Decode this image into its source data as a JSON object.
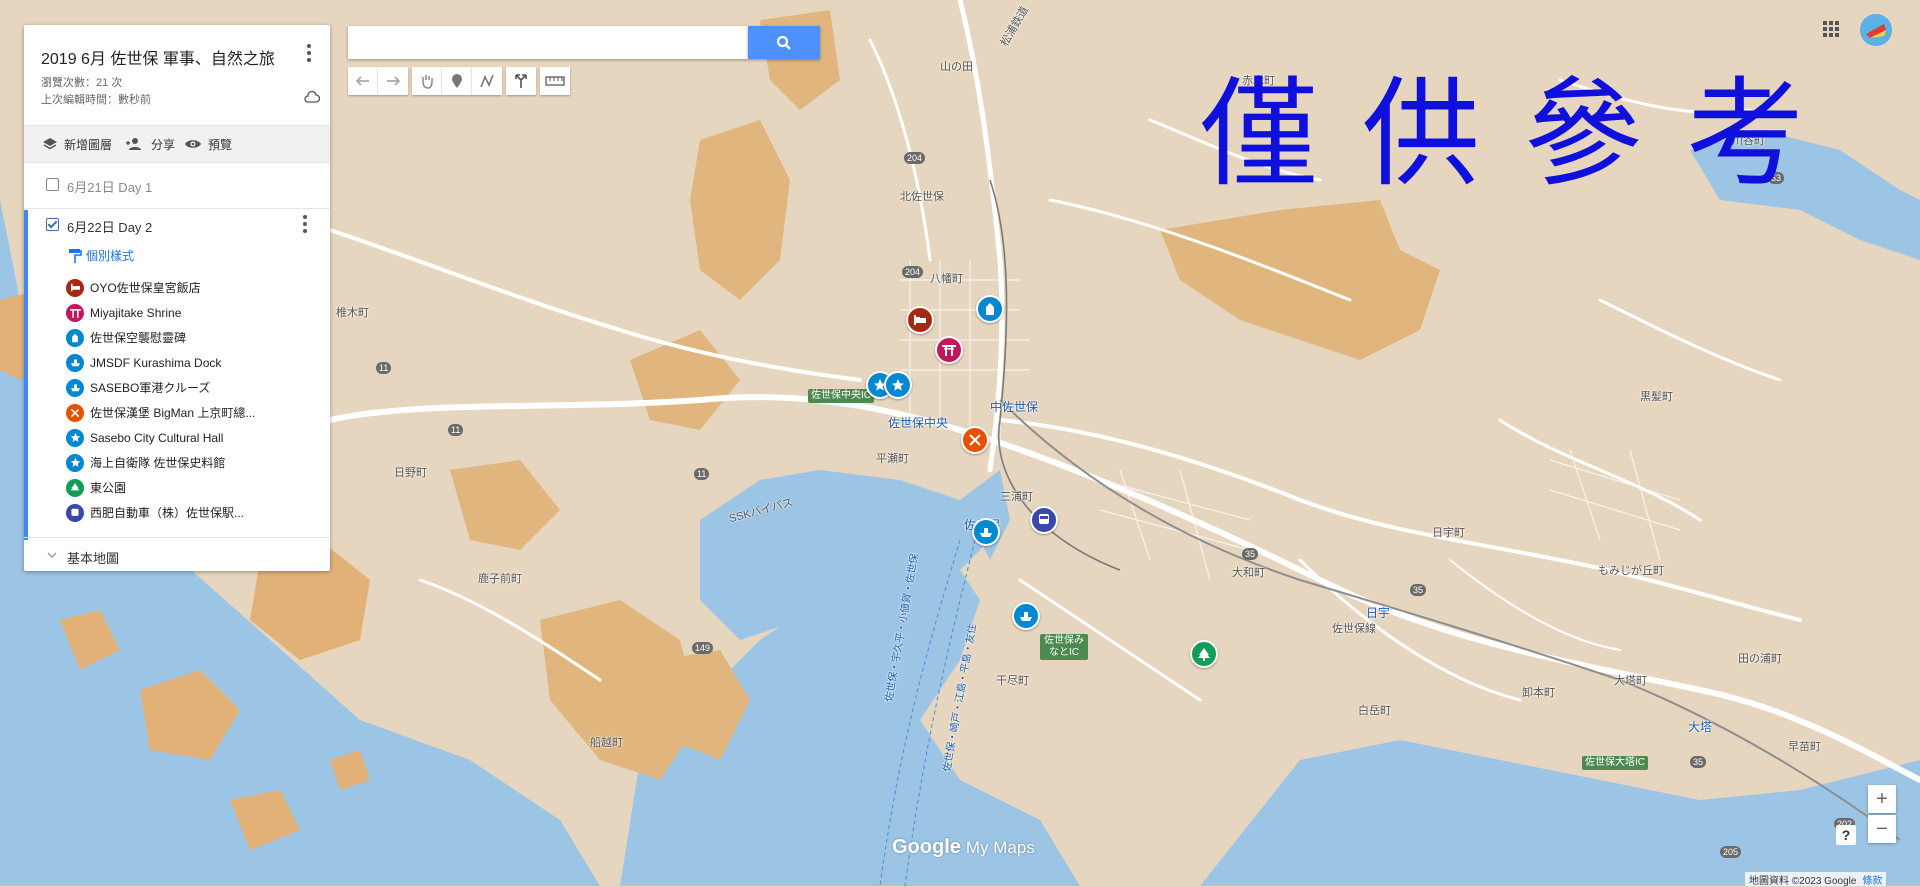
{
  "panel": {
    "title": "2019 6月 佐世保 軍事、自然之旅",
    "views": "瀏覽次數：21 次",
    "last_edit": "上次編輯時間：數秒前",
    "toolbar": {
      "add_layer": "新增圖層",
      "share": "分享",
      "preview": "預覽"
    },
    "layers": [
      {
        "name": "6月21日 Day 1",
        "checked": false
      },
      {
        "name": "6月22日 Day 2",
        "checked": true,
        "style_label": "個別樣式"
      }
    ],
    "places": [
      {
        "name": "OYO佐世保皇宮飯店",
        "color": "#a52714",
        "icon": "bed-icon"
      },
      {
        "name": "Miyajitake Shrine",
        "color": "#c2185b",
        "icon": "torii-icon"
      },
      {
        "name": "佐世保空襲慰靈碑",
        "color": "#0288d1",
        "icon": "monument-icon"
      },
      {
        "name": "JMSDF Kurashima Dock",
        "color": "#0288d1",
        "icon": "ship-icon"
      },
      {
        "name": "SASEBO軍港クルーズ",
        "color": "#0288d1",
        "icon": "ship-icon"
      },
      {
        "name": "佐世保漢堡 BigMan 上京町總...",
        "color": "#e65100",
        "icon": "fork-knife-icon"
      },
      {
        "name": "Sasebo City Cultural Hall",
        "color": "#0288d1",
        "icon": "star-icon"
      },
      {
        "name": "海上自衛隊 佐世保史料館",
        "color": "#0288d1",
        "icon": "star-icon"
      },
      {
        "name": "東公園",
        "color": "#0f9d58",
        "icon": "tree-icon"
      },
      {
        "name": "西肥自動車（株）佐世保駅...",
        "color": "#3949ab",
        "icon": "bus-icon"
      }
    ],
    "base_map": "基本地圖"
  },
  "search": {
    "placeholder": ""
  },
  "watermark": "僅供參考",
  "map_labels": {
    "places": [
      "山の田",
      "赤木町",
      "川谷町",
      "北佐世保",
      "八幡町",
      "椎木町",
      "黒髪町",
      "中佐世保",
      "佐世保中央",
      "平瀬町",
      "三浦町",
      "日野町",
      "日宇町",
      "大和町",
      "もみじが丘町",
      "鹿子前町",
      "日宇",
      "佐世保線",
      "田の浦町",
      "卸本町",
      "大塔町",
      "白岳町",
      "干尽町",
      "大塔",
      "船越町",
      "早苗町",
      "SSKバイパス",
      "佐世保",
      "松浦鉄道"
    ],
    "ics": [
      "佐世保中央IC",
      "佐世保みなとIC",
      "佐世保大塔IC"
    ],
    "routes": [
      "204",
      "204",
      "11",
      "11",
      "11",
      "149",
      "35",
      "35",
      "35",
      "205",
      "202",
      "53"
    ],
    "ferry": [
      "佐世保・宇久平・小値賀・佐世保",
      "佐世保・崎戸・江島・平島・友住"
    ]
  },
  "branding": {
    "logo": "Google",
    "product": "My Maps"
  },
  "attribution": "地圖資料 ©2023 Google",
  "terms": "條款",
  "zoom": {
    "in": "+",
    "out": "−"
  },
  "help": "?"
}
